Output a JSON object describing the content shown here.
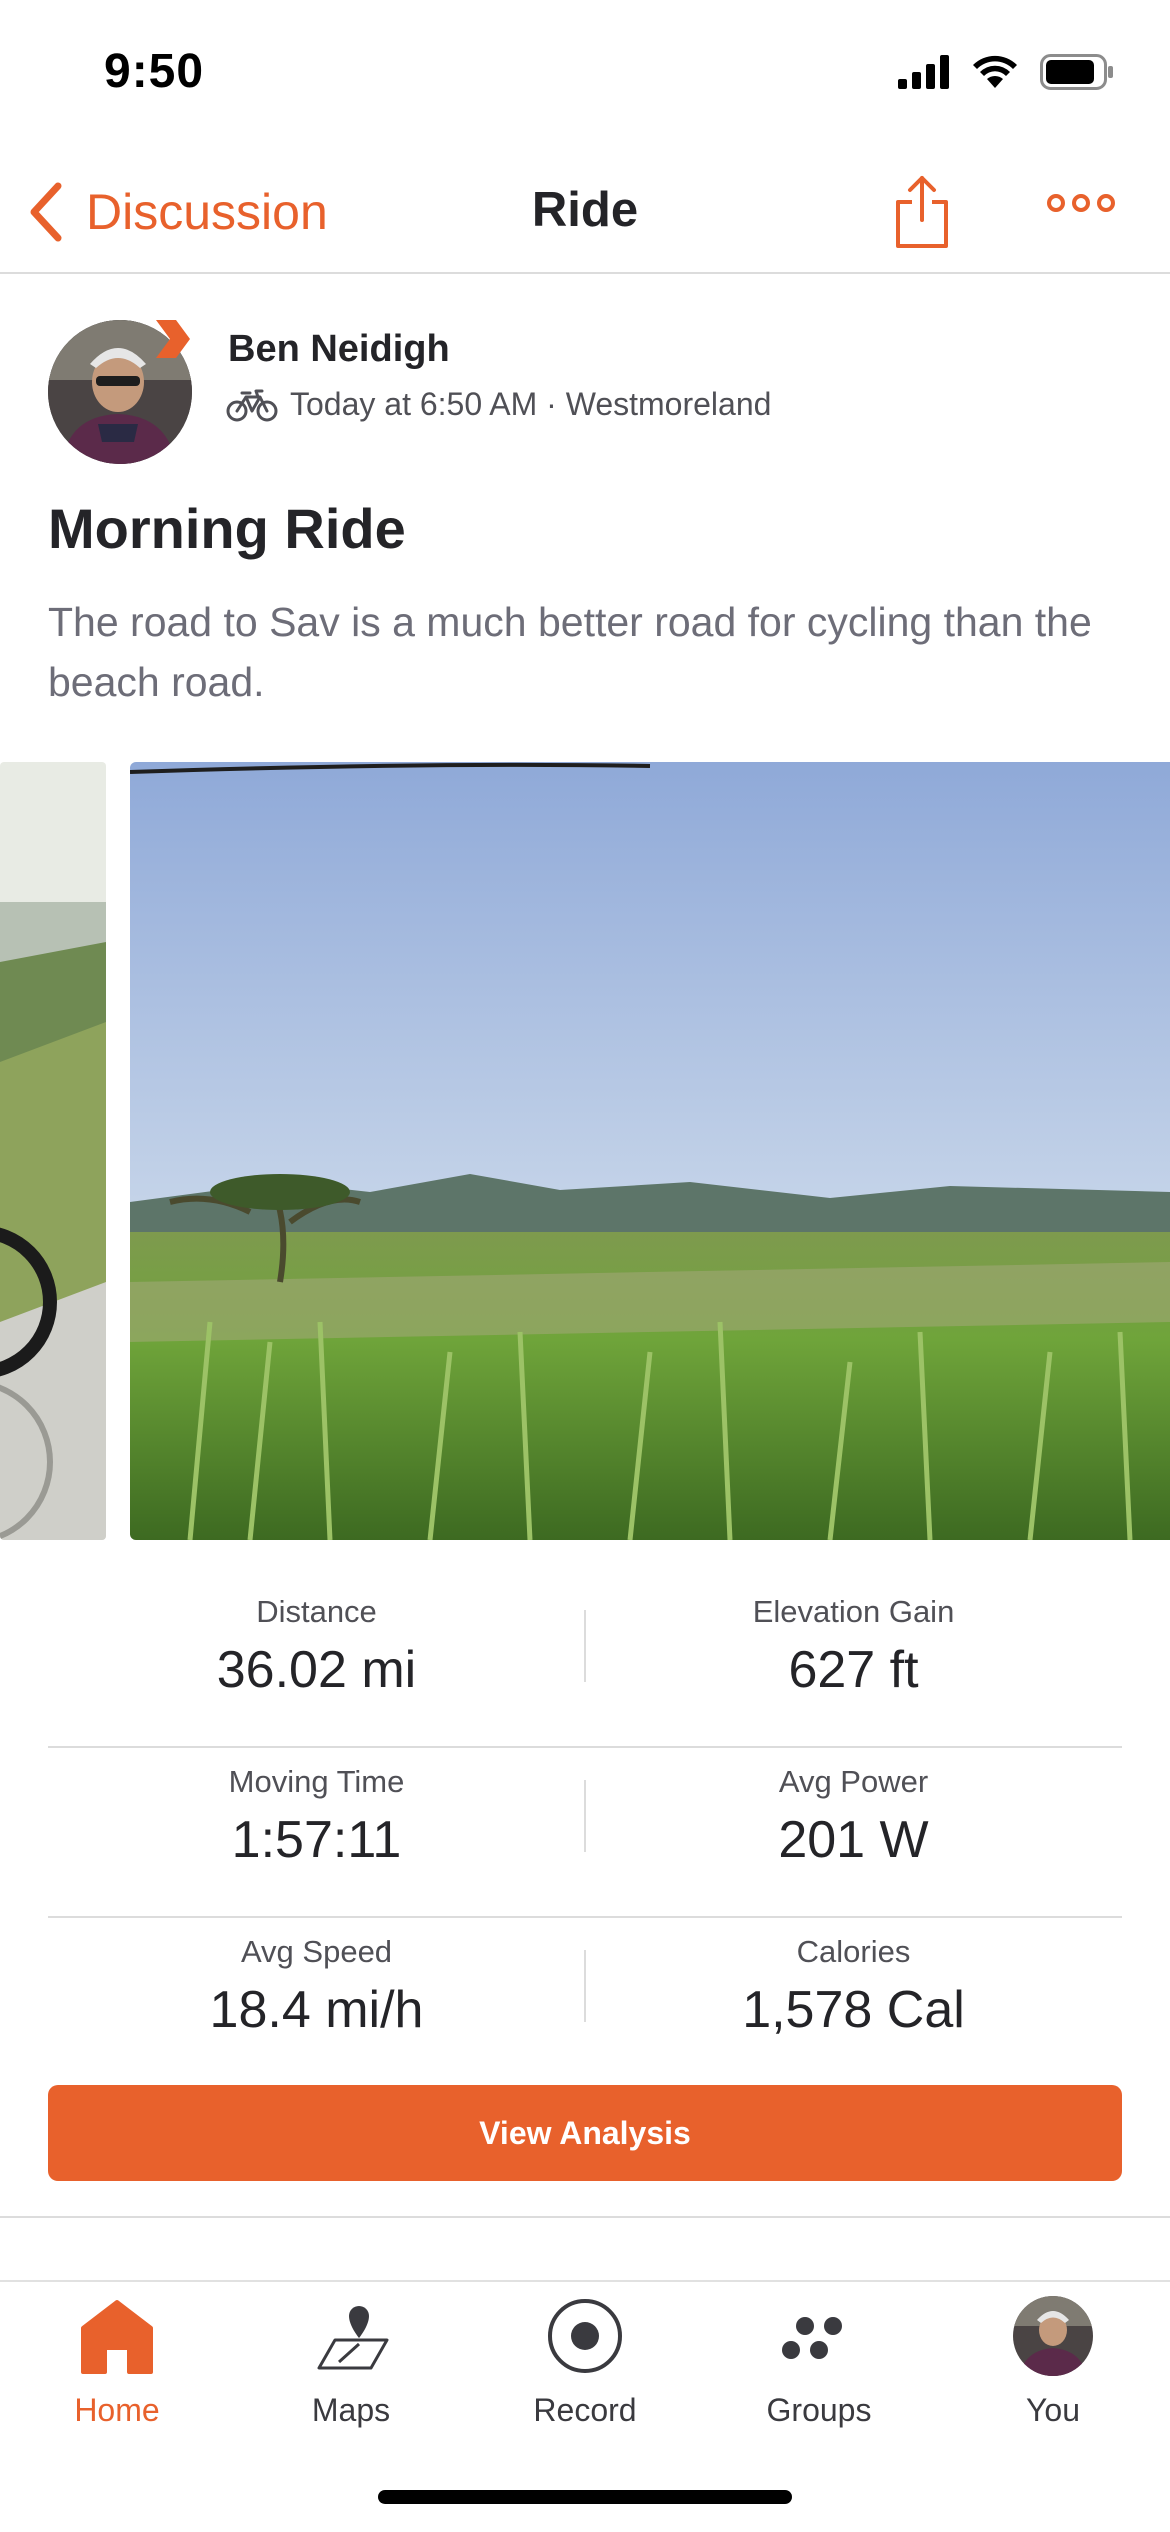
{
  "status_bar": {
    "time": "9:50"
  },
  "nav": {
    "back_label": "Discussion",
    "title": "Ride",
    "share_icon": "share-icon",
    "more_icon": "more-horizontal-icon"
  },
  "activity": {
    "athlete_name": "Ben Neidigh",
    "meta": "Today at 6:50 AM · Westmoreland",
    "activity_type_icon": "bicycle-icon",
    "title": "Morning Ride",
    "description": "The road to Sav is a much better road for cycling than the beach road."
  },
  "stats": [
    {
      "left": {
        "label": "Distance",
        "value": "36.02 mi"
      },
      "right": {
        "label": "Elevation Gain",
        "value": "627 ft"
      }
    },
    {
      "left": {
        "label": "Moving Time",
        "value": "1:57:11"
      },
      "right": {
        "label": "Avg Power",
        "value": "201 W"
      }
    },
    {
      "left": {
        "label": "Avg Speed",
        "value": "18.4 mi/h"
      },
      "right": {
        "label": "Calories",
        "value": "1,578 Cal"
      }
    }
  ],
  "analysis_button": "View Analysis",
  "tab_bar": {
    "active": "Home",
    "tabs": [
      {
        "label": "Home",
        "icon": "home-icon"
      },
      {
        "label": "Maps",
        "icon": "map-icon"
      },
      {
        "label": "Record",
        "icon": "record-icon"
      },
      {
        "label": "Groups",
        "icon": "groups-icon"
      },
      {
        "label": "You",
        "icon": "avatar"
      }
    ]
  },
  "colors": {
    "accent": "#e8612c",
    "text": "#242428",
    "muted": "#6d6d78",
    "divider": "#dcdcdc"
  }
}
